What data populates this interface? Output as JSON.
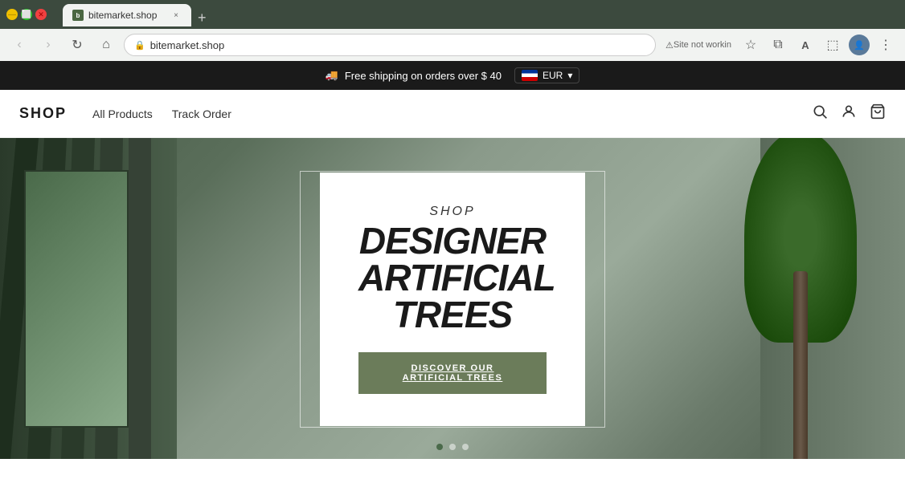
{
  "browser": {
    "tab": {
      "favicon_label": "bitemarket",
      "title": "bitemarket.shop",
      "close_label": "×"
    },
    "new_tab_label": "+",
    "toolbar": {
      "back_label": "‹",
      "forward_label": "›",
      "reload_label": "↻",
      "home_label": "⌂",
      "address": "bitemarket.shop",
      "site_status": "Site not workin",
      "star_label": "☆",
      "extensions_label": "⧉",
      "translate_label": "A",
      "screenshot_label": "⬚",
      "profile_label": "👤",
      "menu_label": "⋮"
    }
  },
  "announcement": {
    "emoji": "🚚",
    "text": "Free shipping on orders over $ 40",
    "currency": {
      "flag": "EU",
      "code": "EUR",
      "chevron": "▾"
    }
  },
  "nav": {
    "logo": "SHOP",
    "links": [
      {
        "label": "All Products",
        "href": "#"
      },
      {
        "label": "Track Order",
        "href": "#"
      }
    ],
    "icons": {
      "search": "🔍",
      "account": "👤",
      "cart": "🛒"
    }
  },
  "hero": {
    "card": {
      "subtitle": "SHOP",
      "title_line1": "DESIGNER",
      "title_line2": "ARTIFICIAL",
      "title_line3": "TREES",
      "cta_prefix": "DISCOVER OUR ",
      "cta_link": "ARTIFICIAL TREES"
    },
    "carousel": {
      "dots": [
        true,
        false,
        false
      ],
      "active_index": 0
    }
  }
}
